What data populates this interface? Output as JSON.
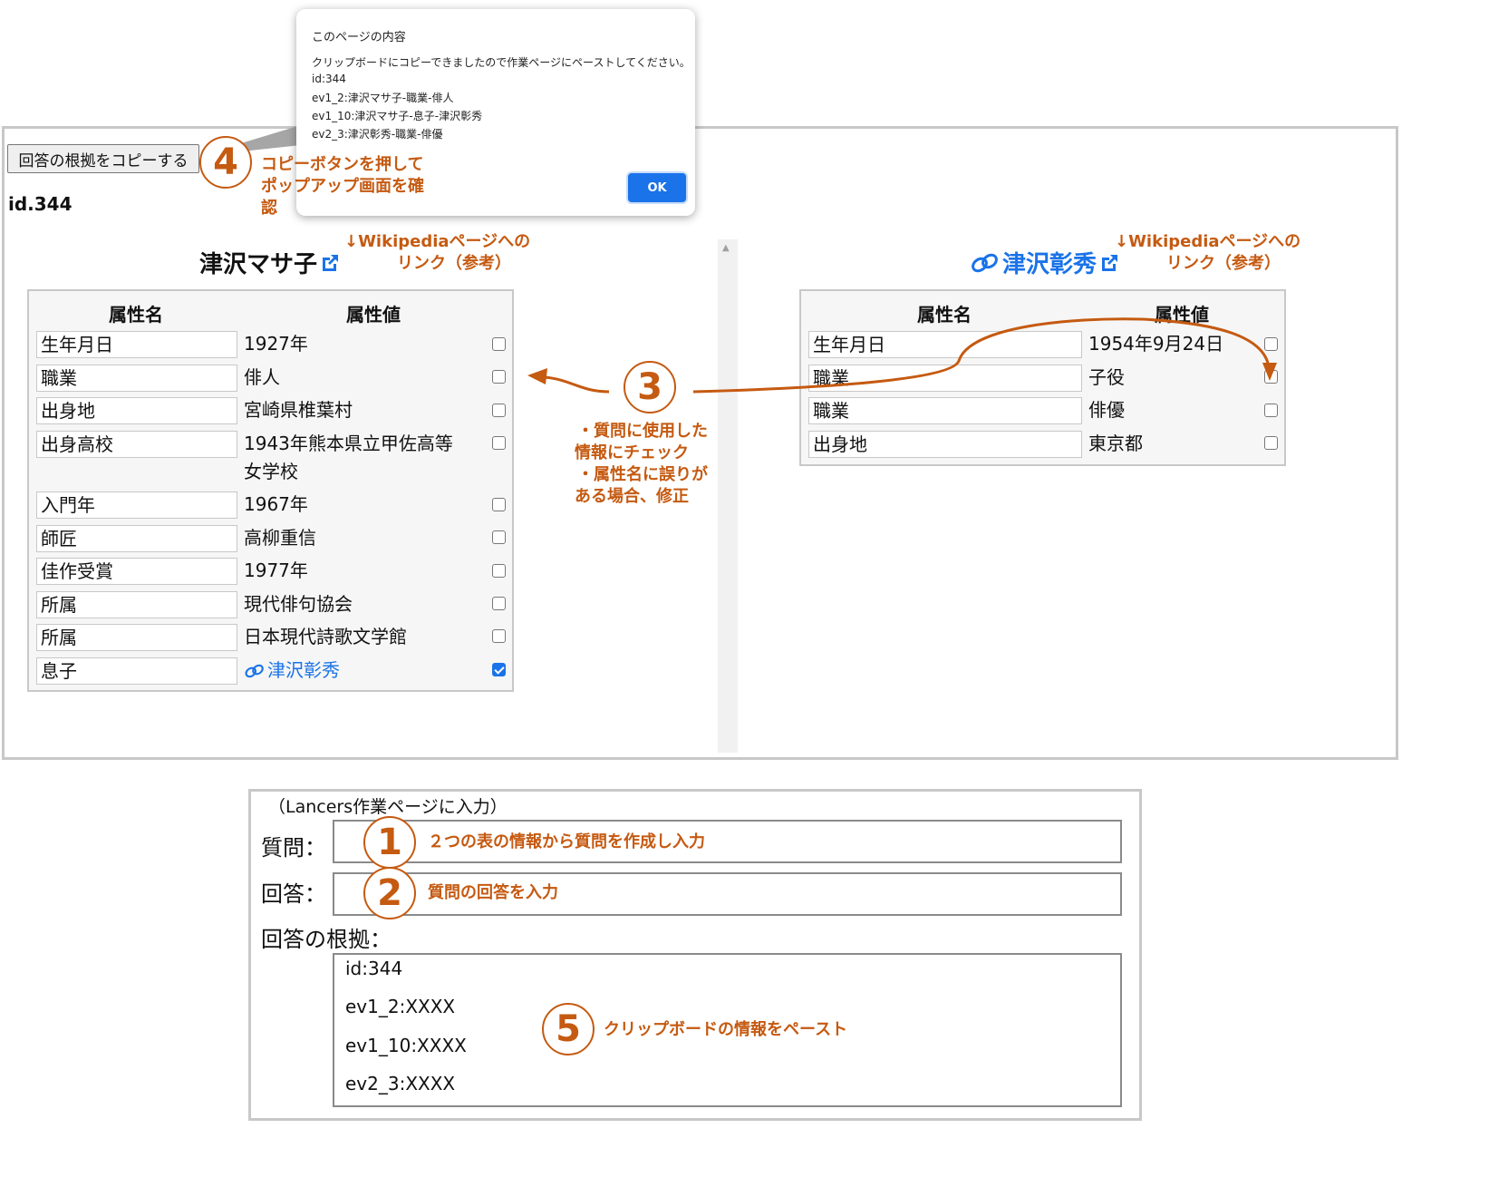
{
  "toolbar": {
    "copy_button_label": "回答の根拠をコピーする"
  },
  "page": {
    "id_label": "id.344"
  },
  "popup": {
    "title": "このページの内容",
    "message": "クリップボードにコピーできましたので作業ページにペーストしてください。",
    "lines": [
      "id:344",
      "ev1_2:津沢マサ子-職業-俳人",
      "ev1_10:津沢マサ子-息子-津沢彰秀",
      "ev2_3:津沢彰秀-職業-俳優"
    ],
    "ok_label": "OK"
  },
  "left_panel": {
    "title": "津沢マサ子",
    "header_name": "属性名",
    "header_value": "属性値",
    "rows": [
      {
        "name": "生年月日",
        "value": "1927年",
        "checked": false
      },
      {
        "name": "職業",
        "value": "俳人",
        "checked": false
      },
      {
        "name": "出身地",
        "value": "宮崎県椎葉村",
        "checked": false
      },
      {
        "name": "出身高校",
        "value": "1943年熊本県立甲佐高等",
        "value2": "女学校",
        "checked": false
      },
      {
        "name": "入門年",
        "value": "1967年",
        "checked": false
      },
      {
        "name": "師匠",
        "value": "高柳重信",
        "checked": false
      },
      {
        "name": "佳作受賞",
        "value": "1977年",
        "checked": false
      },
      {
        "name": "所属",
        "value": "現代俳句協会",
        "checked": false
      },
      {
        "name": "所属",
        "value": "日本現代詩歌文学館",
        "checked": false
      },
      {
        "name": "息子",
        "value": "津沢彰秀",
        "checked": true,
        "link": true
      }
    ]
  },
  "right_panel": {
    "title": "津沢彰秀",
    "header_name": "属性名",
    "header_value": "属性値",
    "rows": [
      {
        "name": "生年月日",
        "value": "1954年9月24日",
        "checked": false
      },
      {
        "name": "職業",
        "value": "子役",
        "checked": false
      },
      {
        "name": "職業",
        "value": "俳優",
        "checked": false
      },
      {
        "name": "出身地",
        "value": "東京都",
        "checked": false
      }
    ]
  },
  "annotations": {
    "step4_num": "4",
    "step4_text_1": "コピーボタンを押して",
    "step4_text_2": "ポップアップ画面を確",
    "step4_text_3": "認",
    "wiki_left_1": "↓Wikipediaページへの",
    "wiki_left_2": "リンク（参考）",
    "wiki_right_1": "↓Wikipediaページへの",
    "wiki_right_2": "リンク（参考）",
    "step3_num": "3",
    "step3_text_1": "・質問に使用した",
    "step3_text_2": "情報にチェック",
    "step3_text_3": "・属性名に誤りが",
    "step3_text_4": "ある場合、修正",
    "step1_num": "1",
    "step1_text": "２つの表の情報から質問を作成し入力",
    "step2_num": "2",
    "step2_text": "質問の回答を入力",
    "step5_num": "5",
    "step5_text": "クリップボードの情報をペースト"
  },
  "form": {
    "caption": "（Lancers作業ページに入力）",
    "question_label": "質問：",
    "answer_label": "回答：",
    "evidence_label": "回答の根拠：",
    "evidence_lines": [
      "id:344",
      "ev1_2:XXXX",
      "ev1_10:XXXX",
      "ev2_3:XXXX"
    ]
  },
  "colors": {
    "annotation": "#c55a11",
    "link": "#1a73e8",
    "ok_button": "#1a73e8"
  },
  "icons": {
    "external_link": "external-link-icon",
    "chain_link": "link-icon",
    "scroll_up": "scroll-up-arrow-icon"
  }
}
